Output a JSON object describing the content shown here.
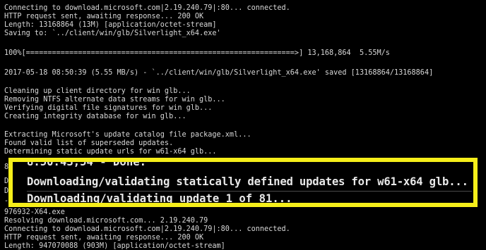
{
  "terminal": {
    "lines_top": [
      "Connecting to download.microsoft.com|2.19.240.79|:80... connected.",
      "HTTP request sent, awaiting response... 200 OK",
      "Length: 13168864 (13M) [application/octet-stream]",
      "Saving to: `../client/win/glb/Silverlight_x64.exe'",
      "",
      "100%[==============================================================>] 13,168,864  5.55M/s",
      "",
      "2017-05-18 08:50:39 (5.55 MB/s) - `../client/win/glb/Silverlight_x64.exe' saved [13168864/13168864]",
      "",
      "Cleaning up client directory for win glb...",
      "Removing NTFS alternate data streams for win glb...",
      "Verifying digital file signatures for win glb...",
      "Creating integrity database for win glb...",
      "",
      "Extracting Microsoft's update catalog file package.xml...",
      "Found valid list of superseded updates.",
      "Determining static update urls for w61-x64 glb..."
    ],
    "left_peek": [
      "8:",
      "Do",
      "Do",
      "--"
    ],
    "lines_bottom": [
      "976932-X64.exe",
      "Resolving download.microsoft.com... 2.19.240.79",
      "Connecting to download.microsoft.com|2.19.240.79|:80... connected.",
      "HTTP request sent, awaiting response... 200 OK",
      "Length: 947070088 (903M) [application/octet-stream]"
    ]
  },
  "highlight": {
    "top_partial": "8:50:43,54 - Done.",
    "main": "Downloading/validating statically defined updates for w61-x64 glb...",
    "bottom_partial": "Downloading/validating update 1 of 81..."
  },
  "colors": {
    "background": "#000000",
    "text": "#d8d8d8",
    "highlight_border": "#f5ee1a"
  }
}
